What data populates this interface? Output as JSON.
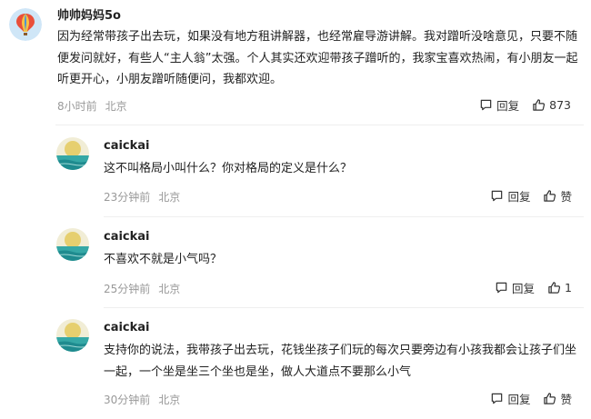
{
  "comments": [
    {
      "author": "帅帅妈妈5o",
      "text": "因为经常带孩子出去玩，如果没有地方租讲解器，也经常雇导游讲解。我对蹭听没啥意见，只要不随便发问就好，有些人“主人翁”太强。个人其实还欢迎带孩子蹭听的，我家宝喜欢热闹，有小朋友一起听更开心，小朋友蹭听随便问，我都欢迎。",
      "time": "8小时前",
      "location": "北京",
      "reply_label": "回复",
      "like_label": "873",
      "avatar_icon": "hot-air-balloon"
    },
    {
      "author": "caickai",
      "text": "这不叫格局小叫什么？你对格局的定义是什么？",
      "time": "23分钟前",
      "location": "北京",
      "reply_label": "回复",
      "like_label": "赞",
      "avatar_icon": "sea-moon-scene"
    },
    {
      "author": "caickai",
      "text": "不喜欢不就是小气吗？",
      "time": "25分钟前",
      "location": "北京",
      "reply_label": "回复",
      "like_label": "1",
      "avatar_icon": "sea-moon-scene"
    },
    {
      "author": "caickai",
      "text": "支持你的说法，我带孩子出去玩，花钱坐孩子们玩的每次只要旁边有小孩我都会让孩子们坐一起，一个坐是坐三个坐也是坐，做人大道点不要那么小气",
      "time": "30分钟前",
      "location": "北京",
      "reply_label": "回复",
      "like_label": "赞",
      "avatar_icon": "sea-moon-scene"
    }
  ],
  "colors": {
    "meta": "#999999",
    "text": "#222222",
    "divider": "#efefef"
  }
}
